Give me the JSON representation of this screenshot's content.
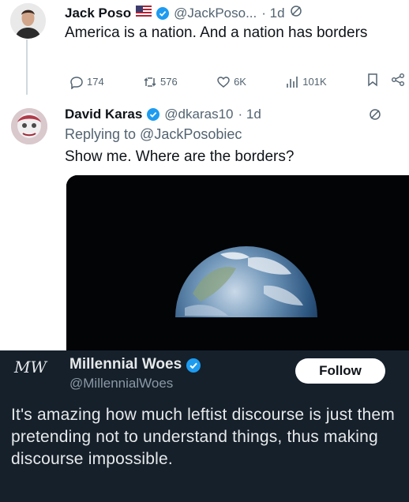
{
  "tweet": {
    "author_name": "Jack Poso",
    "handle": "@JackPoso...",
    "time": "· 1d",
    "text": "America is a nation. And a nation has borders",
    "stats": {
      "replies": "174",
      "retweets": "576",
      "likes": "6K",
      "views": "101K"
    }
  },
  "reply": {
    "author_name": "David Karas",
    "handle": "@dkaras10",
    "time": "· 1d",
    "replying_to": "Replying to @JackPosobiec",
    "text": "Show me. Where are the borders?"
  },
  "caption": {
    "author_name": "Millennial Woes",
    "handle": "@MillennialWoes",
    "avatar_text": "MW",
    "follow_label": "Follow",
    "text": "It's amazing how much leftist discourse is just them pretending not to understand things, thus making discourse impossible."
  },
  "colors": {
    "verified": "#1d9bf0",
    "dark_bg": "#15202b",
    "muted": "#536471"
  },
  "icons": [
    "flag-icon",
    "verified-icon",
    "grok-icon",
    "reply-icon",
    "retweet-icon",
    "like-icon",
    "views-icon",
    "bookmark-icon",
    "share-icon",
    "earth-photo"
  ]
}
